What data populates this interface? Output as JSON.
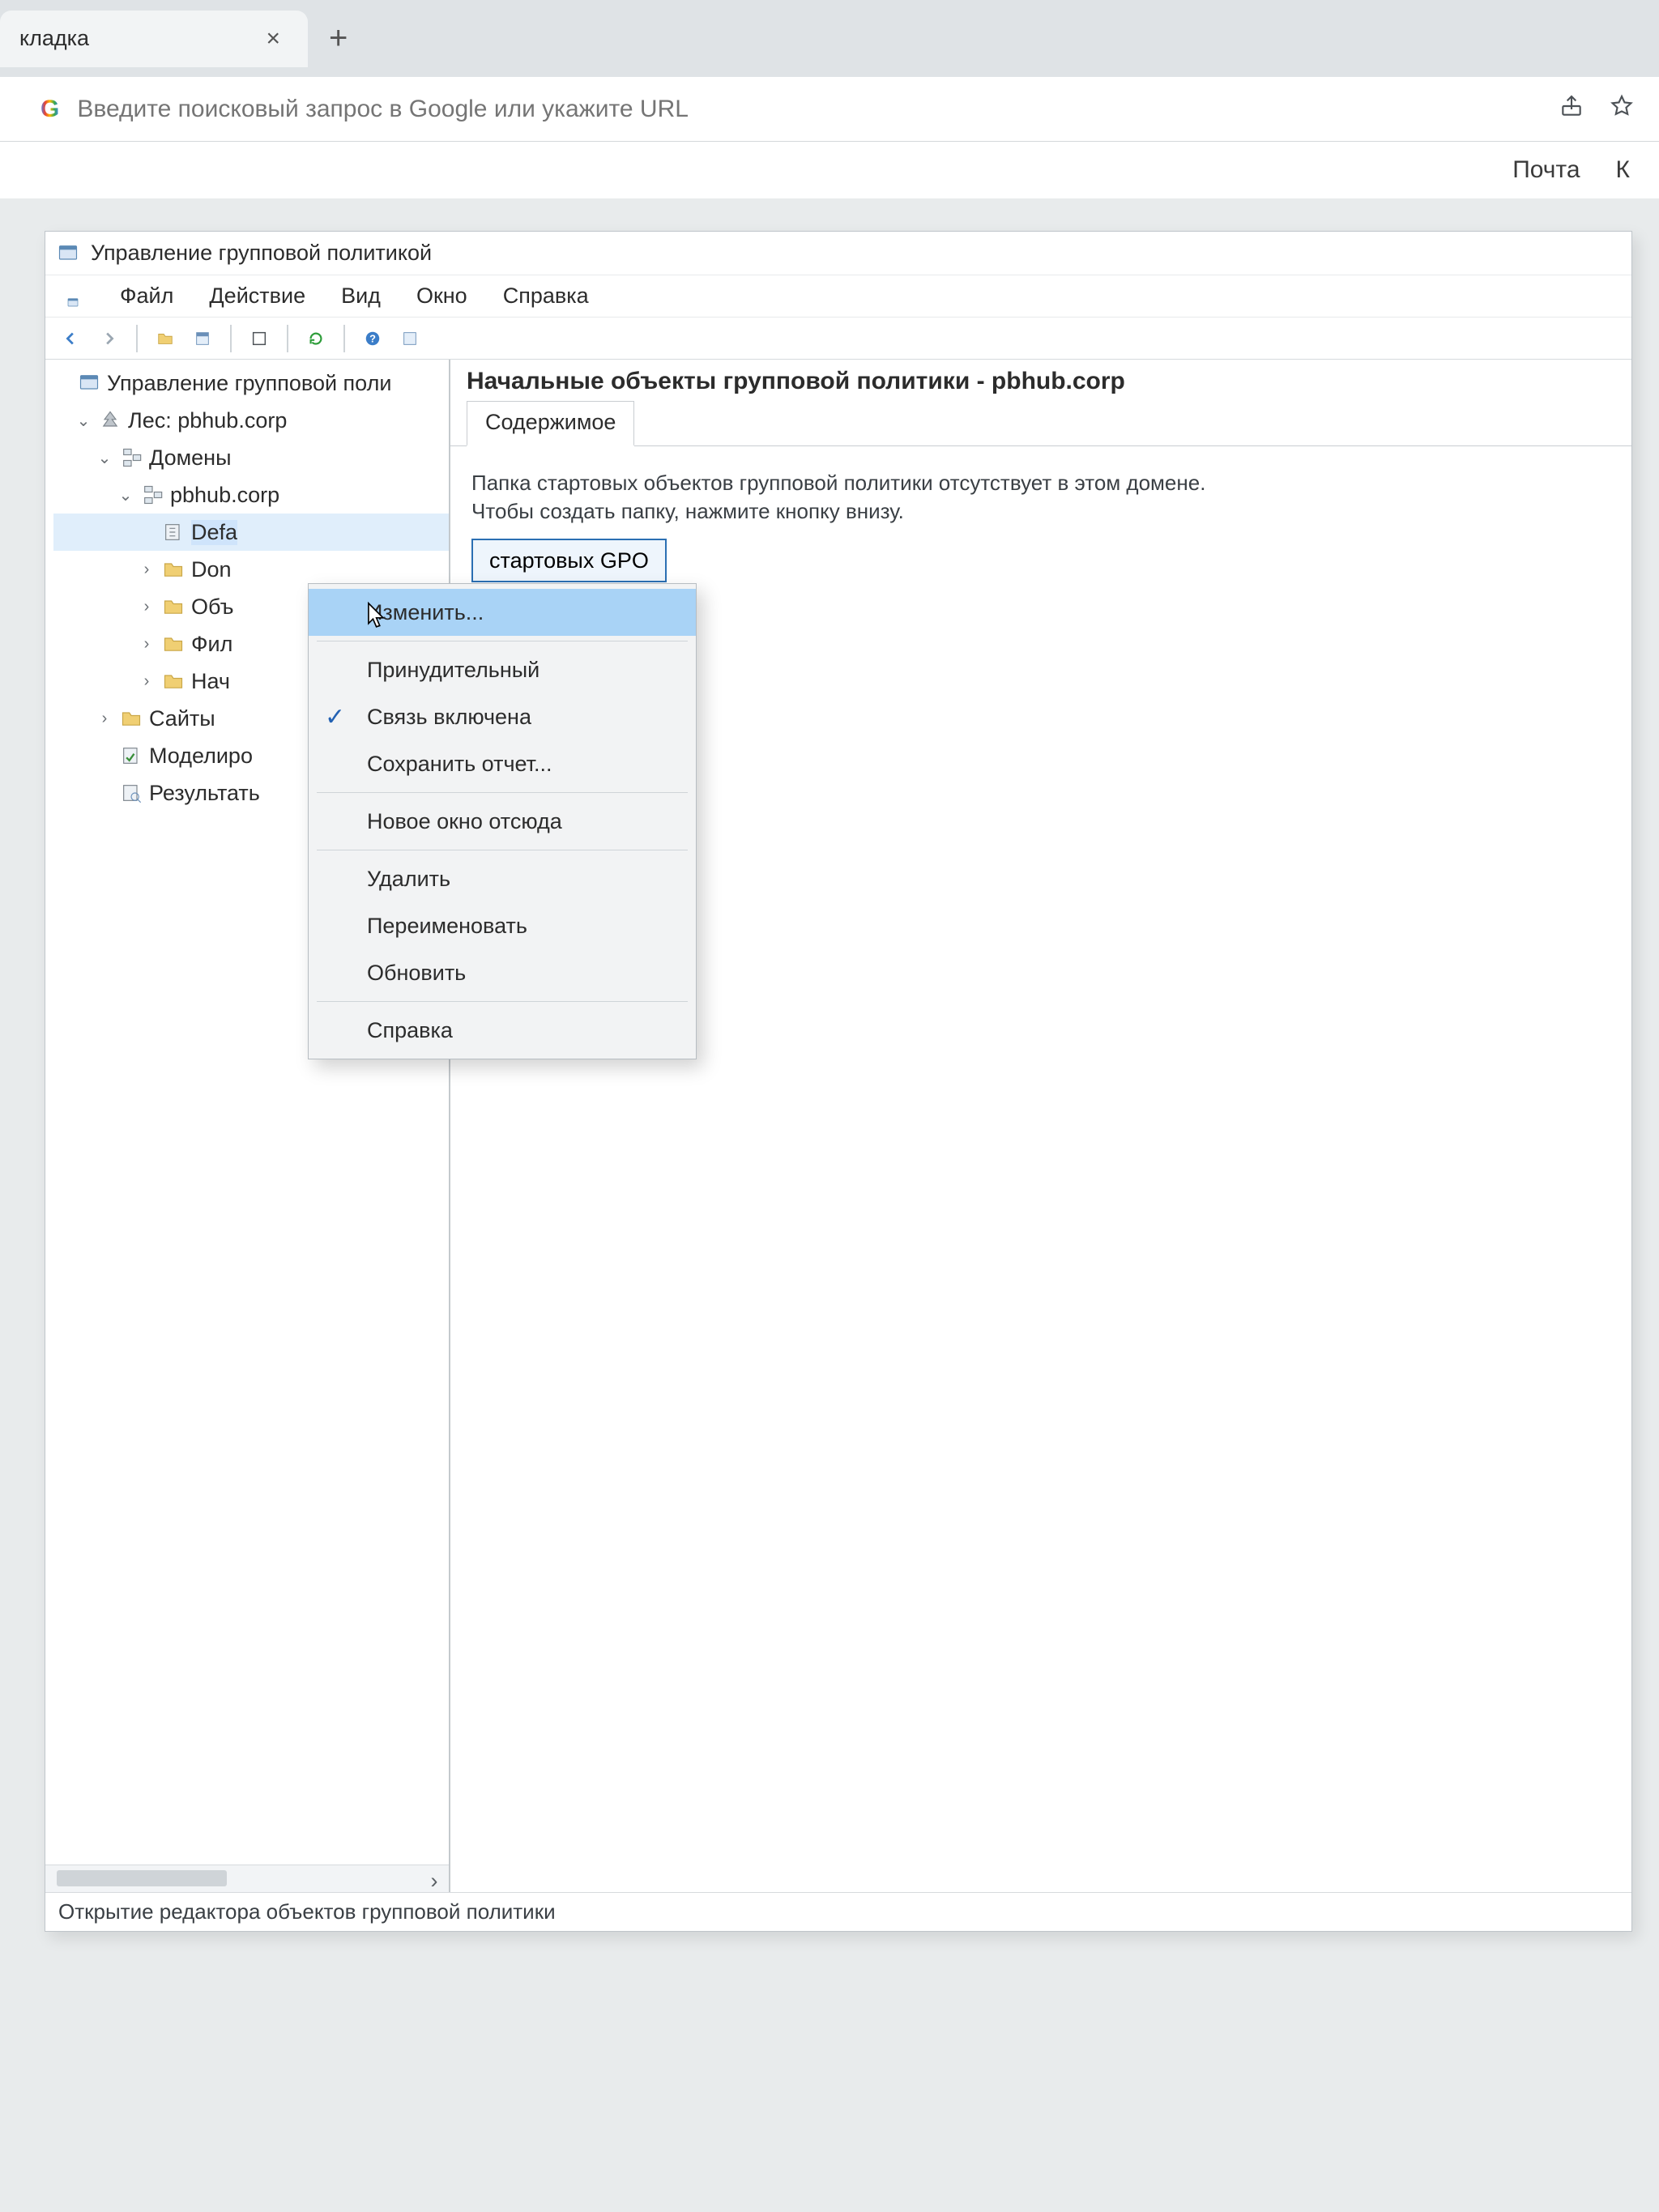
{
  "browser": {
    "tab_title": "кладка",
    "addr_placeholder": "Введите поисковый запрос в Google или укажите URL",
    "bookmarks": {
      "mail": "Почта",
      "k": "К"
    }
  },
  "app": {
    "title": "Управление групповой политикой",
    "menubar": {
      "file": "Файл",
      "action": "Действие",
      "view": "Вид",
      "window": "Окно",
      "help": "Справка"
    },
    "statusbar": "Открытие редактора объектов групповой политики"
  },
  "tree": {
    "root": "Управление групповой поли",
    "forest": "Лес: pbhub.corp",
    "domains": "Домены",
    "domain": "pbhub.corp",
    "items": {
      "default": "Defa",
      "don": "Don",
      "obj": "Объ",
      "fil": "Фил",
      "nach": "Нач"
    },
    "sites": "Сайты",
    "modeling": "Моделиро",
    "results": "Результать"
  },
  "content": {
    "title": "Начальные объекты групповой политики - pbhub.corp",
    "tab": "Содержимое",
    "line1": "Папка стартовых объектов групповой политики отсутствует в этом домене.",
    "line2": "Чтобы создать папку, нажмите кнопку внизу.",
    "button_partial": "стартовых GPO"
  },
  "ctx": {
    "edit": "Изменить...",
    "enforced": "Принудительный",
    "link_enabled": "Связь включена",
    "save_report": "Сохранить отчет...",
    "new_window": "Новое окно отсюда",
    "delete": "Удалить",
    "rename": "Переименовать",
    "refresh": "Обновить",
    "help": "Справка"
  }
}
